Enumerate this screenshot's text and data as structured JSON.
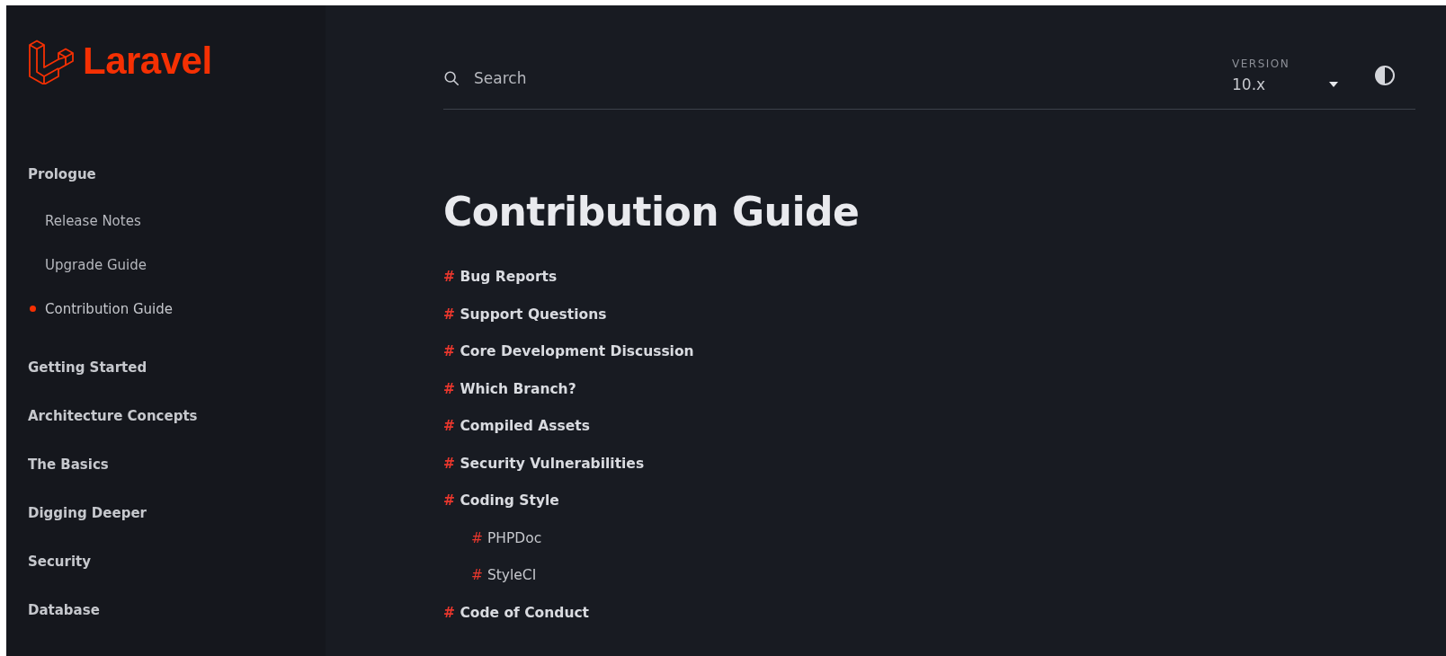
{
  "logo": {
    "text": "Laravel"
  },
  "sidebar": {
    "sections": [
      {
        "label": "Prologue",
        "children": [
          {
            "label": "Release Notes",
            "selected": false
          },
          {
            "label": "Upgrade Guide",
            "selected": false
          },
          {
            "label": "Contribution Guide",
            "selected": true
          }
        ]
      },
      {
        "label": "Getting Started"
      },
      {
        "label": "Architecture Concepts"
      },
      {
        "label": "The Basics"
      },
      {
        "label": "Digging Deeper"
      },
      {
        "label": "Security"
      },
      {
        "label": "Database"
      }
    ]
  },
  "search": {
    "placeholder": "Search"
  },
  "version": {
    "label": "VERSION",
    "value": "10.x"
  },
  "title": "Contribution Guide",
  "toc": [
    {
      "mark": "#",
      "label": "Bug Reports"
    },
    {
      "mark": "#",
      "label": "Support Questions"
    },
    {
      "mark": "#",
      "label": "Core Development Discussion"
    },
    {
      "mark": "#",
      "label": "Which Branch?"
    },
    {
      "mark": "#",
      "label": "Compiled Assets"
    },
    {
      "mark": "#",
      "label": "Security Vulnerabilities"
    },
    {
      "mark": "#",
      "label": "Coding Style",
      "children": [
        {
          "mark": "#",
          "label": "PHPDoc"
        },
        {
          "mark": "#",
          "label": "StyleCI"
        }
      ]
    },
    {
      "mark": "#",
      "label": "Code of Conduct"
    }
  ]
}
